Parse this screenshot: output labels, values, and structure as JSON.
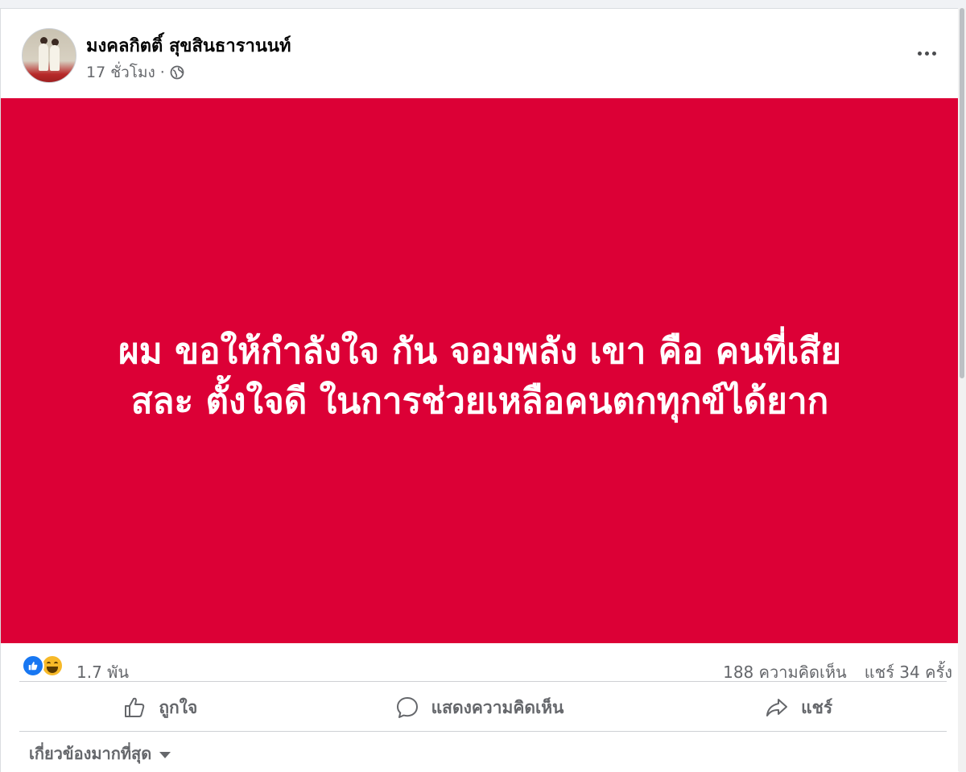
{
  "post": {
    "author": "มงคลกิตติ์ สุขสินธารานนท์",
    "timestamp": "17 ชั่วโมง",
    "separator": "·",
    "privacy_icon": "globe-icon",
    "more_icon": "more-options-icon",
    "avatar_icon": "profile-photo"
  },
  "banner": {
    "text": "ผม ขอให้กำลังใจ กัน จอมพลัง เขา คือ คนที่เสียสละ ตั้งใจดี ในการช่วยเหลือคนตกทุกข์ได้ยาก",
    "line1": "ผม ขอให้กำลังใจ กัน จอมพลัง เขา คือ คนที่เสีย",
    "line2": "สละ ตั้งใจดี ในการช่วยเหลือคนตกทุกข์ได้ยาก",
    "background_color": "#dc0036",
    "text_color": "#ffffff"
  },
  "stats": {
    "reactions_count": "1.7 พัน",
    "reaction_icons": [
      "like-icon",
      "haha-icon"
    ],
    "comments": "188 ความคิดเห็น",
    "shares": "แชร์ 34 ครั้ง"
  },
  "actions": {
    "like_label": "ถูกใจ",
    "comment_label": "แสดงความคิดเห็น",
    "share_label": "แชร์"
  },
  "comments_filter": {
    "label": "เกี่ยวข้องมากที่สุด"
  },
  "colors": {
    "accent": "#1877f2",
    "secondary_text": "#65676b",
    "banner_red": "#dc0036"
  }
}
